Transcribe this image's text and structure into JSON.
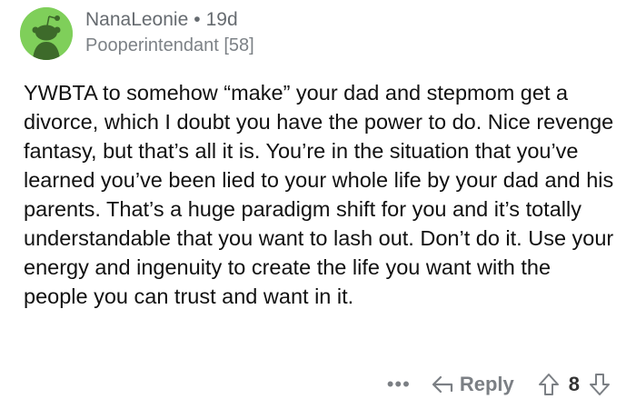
{
  "comment": {
    "username": "NanaLeonie",
    "separator": "•",
    "age": "19d",
    "flair": "Pooperintendant [58]",
    "body": "YWBTA to somehow “make” your dad and stepmom get a divorce, which I doubt you have the power to do. Nice revenge fantasy, but that’s all it is. You’re in the situation that you’ve learned you’ve been lied to your whole life by your dad and his parents. That’s a huge paradigm shift for you and it’s totally understandable that you want to lash out. Don’t do it. Use your energy and ingenuity to create the life you want with the people you can trust and want in it.",
    "avatar_icon": "snoo-avatar-icon",
    "avatar_color": "#7fcf5a"
  },
  "actions": {
    "more_label": "•••",
    "more_icon": "more-options-icon",
    "reply_label": "Reply",
    "reply_icon": "reply-arrow-icon",
    "upvote_icon": "upvote-arrow-icon",
    "score": "8",
    "downvote_icon": "downvote-arrow-icon",
    "icon_color": "#7b7f84"
  }
}
